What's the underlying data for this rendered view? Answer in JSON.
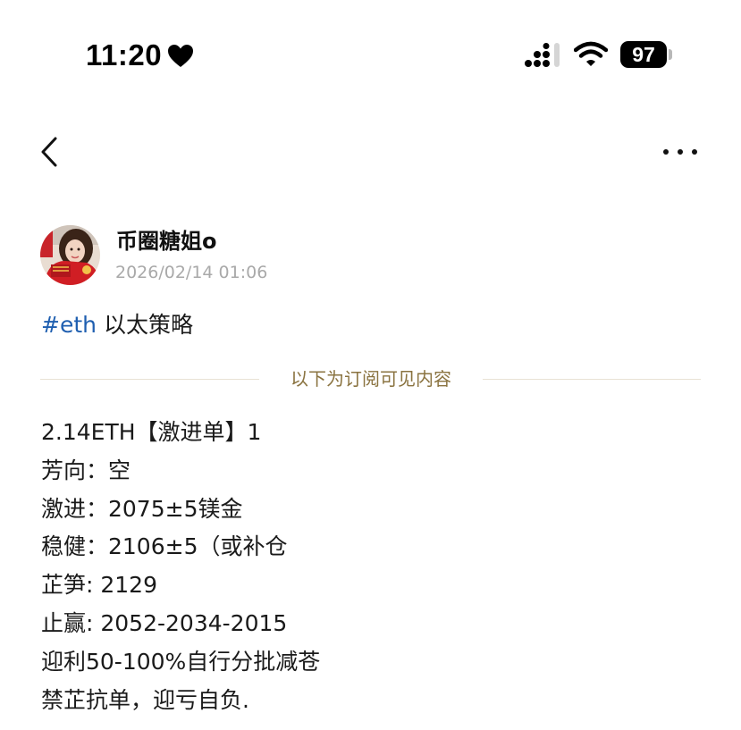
{
  "status_bar": {
    "time": "11:20",
    "battery": "97",
    "icons": [
      "heart-icon",
      "signal-icon",
      "wifi-icon",
      "battery-icon"
    ]
  },
  "nav": {
    "back_icon": "chevron-left-icon",
    "more_icon": "more-horizontal-icon"
  },
  "post": {
    "author": "币圈糖姐o",
    "timestamp": "2026/02/14 01:06",
    "hashtag": "#eth",
    "title": "以太策略",
    "divider_text": "以下为订阅可见内容",
    "lines": [
      "2.14ETH【激进单】1",
      "芳向：空",
      "激进：2075±5镁金",
      "稳健：2106±5（或补仓",
      "芷笋: 2129",
      "止赢: 2052-2034-2015",
      "迎利50-100%自行分批减苍",
      "禁芷抗单，迎亏自负."
    ]
  },
  "colors": {
    "hashtag": "#1f5fb0",
    "divider_text": "#8a7340",
    "timestamp": "#a9a9a9"
  }
}
